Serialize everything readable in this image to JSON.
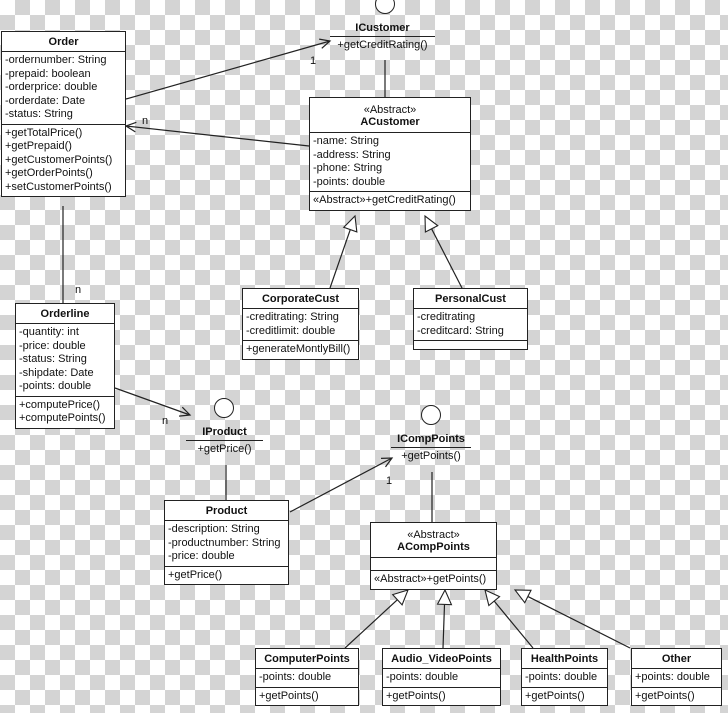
{
  "classes": [
    {
      "id": "order",
      "name": "Order",
      "stereotype": "",
      "attributes": [
        "-ordernumber: String",
        "-prepaid: boolean",
        "-orderprice: double",
        "-orderdate: Date",
        "-status: String"
      ],
      "methods": [
        "+getTotalPrice()",
        "+getPrepaid()",
        "+getCustomerPoints()",
        "+getOrderPoints()",
        "+setCustomerPoints()"
      ]
    },
    {
      "id": "acustomer",
      "name": "ACustomer",
      "stereotype": "«Abstract»",
      "attributes": [
        "-name: String",
        "-address: String",
        "-phone: String",
        "-points: double"
      ],
      "methods": [
        "«Abstract»+getCreditRating()"
      ]
    },
    {
      "id": "corporatecust",
      "name": "CorporateCust",
      "stereotype": "",
      "attributes": [
        "-creditrating: String",
        "-creditlimit: double"
      ],
      "methods": [
        "+generateMontlyBill()"
      ]
    },
    {
      "id": "personalcust",
      "name": "PersonalCust",
      "stereotype": "",
      "attributes": [
        "-creditrating",
        "-creditcard: String"
      ],
      "methods": []
    },
    {
      "id": "orderline",
      "name": "Orderline",
      "stereotype": "",
      "attributes": [
        "-quantity: int",
        "-price: double",
        "-status: String",
        "-shipdate: Date",
        "-points: double"
      ],
      "methods": [
        "+computePrice()",
        "+computePoints()"
      ]
    },
    {
      "id": "product",
      "name": "Product",
      "stereotype": "",
      "attributes": [
        "-description: String",
        "-productnumber: String",
        "-price: double"
      ],
      "methods": [
        "+getPrice()"
      ]
    },
    {
      "id": "acomppoints",
      "name": "ACompPoints",
      "stereotype": "«Abstract»",
      "attributes": [],
      "methods": [
        "«Abstract»+getPoints()"
      ]
    },
    {
      "id": "computerpoints",
      "name": "ComputerPoints",
      "stereotype": "",
      "attributes": [
        "-points: double"
      ],
      "methods": [
        "+getPoints()"
      ]
    },
    {
      "id": "audiovideopoints",
      "name": "Audio_VideoPoints",
      "stereotype": "",
      "attributes": [
        "-points: double"
      ],
      "methods": [
        "+getPoints()"
      ]
    },
    {
      "id": "healthpoints",
      "name": "HealthPoints",
      "stereotype": "",
      "attributes": [
        "-points: double"
      ],
      "methods": [
        "+getPoints()"
      ]
    },
    {
      "id": "other",
      "name": "Other",
      "stereotype": "",
      "attributes": [
        "+points: double"
      ],
      "methods": [
        "+getPoints()"
      ]
    }
  ],
  "interfaces": [
    {
      "id": "icustomer",
      "name": "ICustomer",
      "methods": [
        "+getCreditRating()"
      ]
    },
    {
      "id": "iproduct",
      "name": "IProduct",
      "methods": [
        "+getPrice()"
      ]
    },
    {
      "id": "icomppoints",
      "name": "ICompPoints",
      "methods": [
        "+getPoints()"
      ]
    }
  ],
  "relations": [
    {
      "type": "association",
      "from": "order",
      "to": "icustomer",
      "multiplicity": "1"
    },
    {
      "type": "association",
      "from": "acustomer",
      "to": "order",
      "multiplicity": "n"
    },
    {
      "type": "realization",
      "from": "acustomer",
      "to": "icustomer"
    },
    {
      "type": "generalization",
      "from": "corporatecust",
      "to": "acustomer"
    },
    {
      "type": "generalization",
      "from": "personalcust",
      "to": "acustomer"
    },
    {
      "type": "association",
      "from": "order",
      "to": "orderline",
      "multiplicity": "n"
    },
    {
      "type": "association",
      "from": "orderline",
      "to": "iproduct",
      "multiplicity": "n"
    },
    {
      "type": "realization",
      "from": "product",
      "to": "iproduct"
    },
    {
      "type": "association",
      "from": "product",
      "to": "icomppoints",
      "multiplicity": "1"
    },
    {
      "type": "realization",
      "from": "acomppoints",
      "to": "icomppoints"
    },
    {
      "type": "generalization",
      "from": "computerpoints",
      "to": "acomppoints"
    },
    {
      "type": "generalization",
      "from": "audiovideopoints",
      "to": "acomppoints"
    },
    {
      "type": "generalization",
      "from": "healthpoints",
      "to": "acomppoints"
    },
    {
      "type": "generalization",
      "from": "other",
      "to": "acomppoints"
    }
  ],
  "colors": {
    "line": "#222222",
    "box": "#ffffff"
  }
}
